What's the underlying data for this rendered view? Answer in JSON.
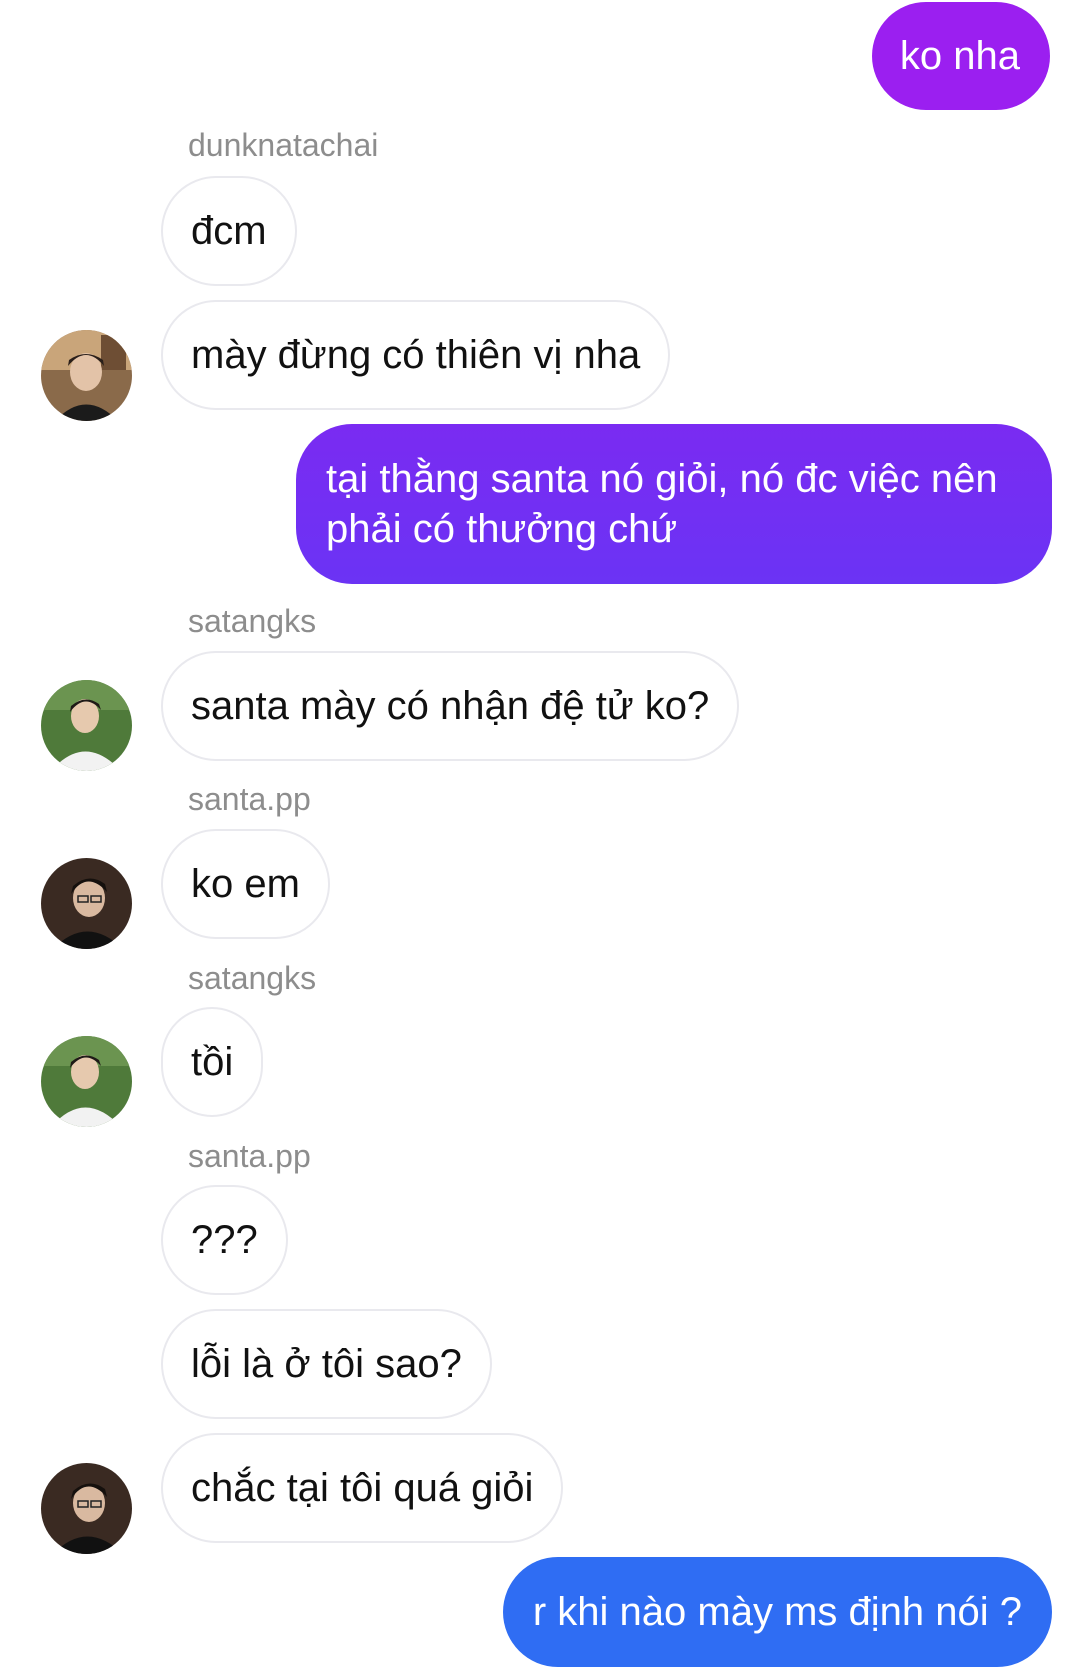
{
  "colors": {
    "outgoing_top": "#9b1ff0",
    "outgoing_mid": "#6b33f4",
    "outgoing_bottom": "#2f6df3",
    "incoming_border": "#e9e9ee",
    "sender_name": "#8d8d8d"
  },
  "messages": [
    {
      "id": "m1",
      "direction": "outgoing",
      "text": "ko nha"
    },
    {
      "id": "s1",
      "type": "sender",
      "text": "dunknatachai"
    },
    {
      "id": "m2",
      "direction": "incoming",
      "text": "đcm"
    },
    {
      "id": "m3",
      "direction": "incoming",
      "text": "mày đừng có thiên vị nha",
      "avatar": "avatar-dunknatachai"
    },
    {
      "id": "m4",
      "direction": "outgoing",
      "text": "tại thằng santa nó giỏi, nó đc việc nên phải có thưởng chứ"
    },
    {
      "id": "s2",
      "type": "sender",
      "text": "satangks"
    },
    {
      "id": "m5",
      "direction": "incoming",
      "text": "santa mày có nhận đệ tử ko?",
      "avatar": "avatar-satangks"
    },
    {
      "id": "s3",
      "type": "sender",
      "text": "santa.pp"
    },
    {
      "id": "m6",
      "direction": "incoming",
      "text": "ko em",
      "avatar": "avatar-santa"
    },
    {
      "id": "s4",
      "type": "sender",
      "text": "satangks"
    },
    {
      "id": "m7",
      "direction": "incoming",
      "text": "tồi",
      "avatar": "avatar-satangks"
    },
    {
      "id": "s5",
      "type": "sender",
      "text": "santa.pp"
    },
    {
      "id": "m8",
      "direction": "incoming",
      "text": "???"
    },
    {
      "id": "m9",
      "direction": "incoming",
      "text": "lỗi là ở tôi sao?"
    },
    {
      "id": "m10",
      "direction": "incoming",
      "text": "chắc tại tôi quá giỏi",
      "avatar": "avatar-santa"
    },
    {
      "id": "m11",
      "direction": "outgoing",
      "text": "r khi nào mày ms định nói ?"
    }
  ]
}
